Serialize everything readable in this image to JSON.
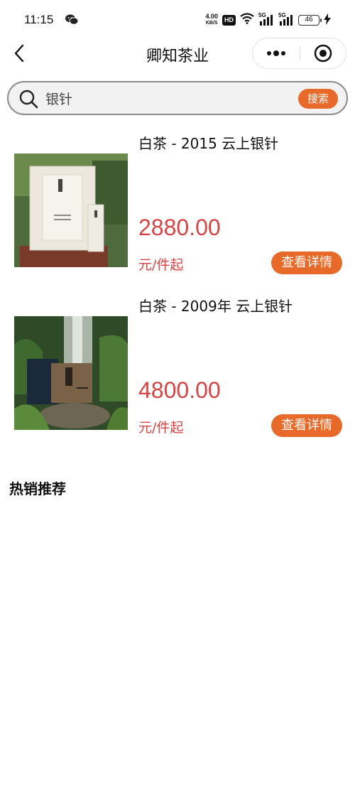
{
  "status_bar": {
    "time": "11:15",
    "net_speed_value": "4.00",
    "net_speed_unit": "KB/S",
    "hd_badge": "HD",
    "signal_1": "5G",
    "signal_2": "5G",
    "battery": "46"
  },
  "nav": {
    "title": "卿知茶业"
  },
  "search": {
    "value": "银针",
    "button_label": "搜索"
  },
  "products": [
    {
      "title": "白茶 - 2015 云上银针",
      "price": "2880.00",
      "unit": "元/件起",
      "button_label": "查看详情"
    },
    {
      "title": "白茶 - 2009年 云上银针",
      "price": "4800.00",
      "unit": "元/件起",
      "button_label": "查看详情"
    }
  ],
  "section": {
    "hot_title": "热销推荐"
  },
  "colors": {
    "accent": "#e86a2a",
    "price": "#d64545"
  }
}
